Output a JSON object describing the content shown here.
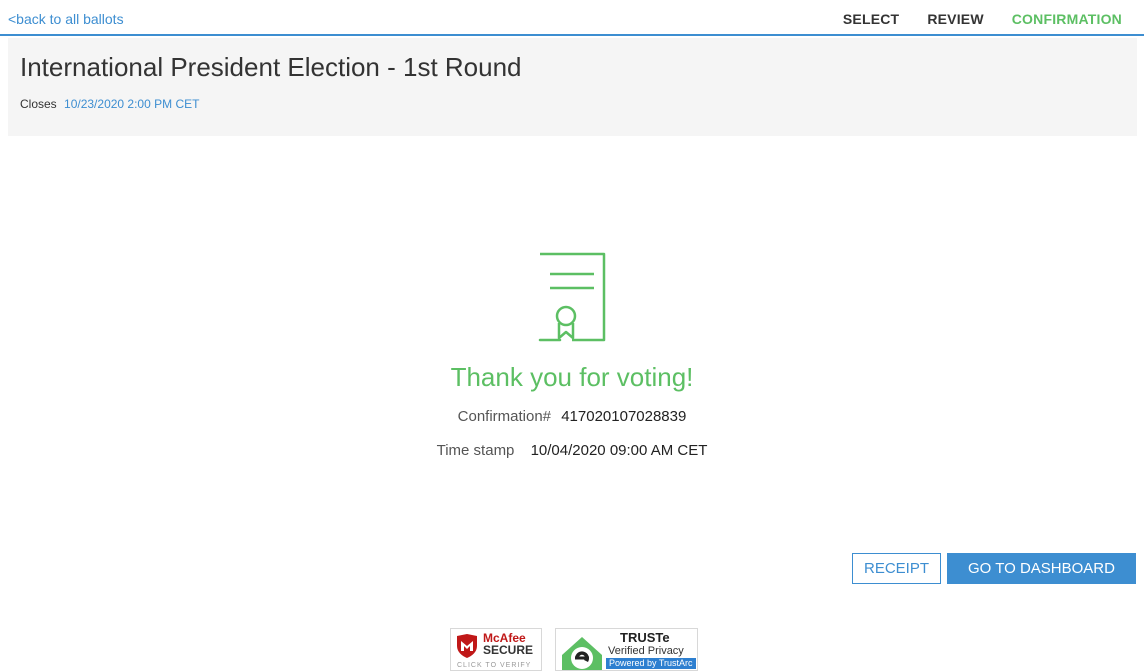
{
  "nav": {
    "back_label": "<back to all ballots",
    "steps": [
      {
        "label": "SELECT",
        "active": false
      },
      {
        "label": "REVIEW",
        "active": false
      },
      {
        "label": "CONFIRMATION",
        "active": true
      }
    ]
  },
  "election": {
    "title": "International President Election - 1st Round",
    "closes_label": "Closes",
    "closes_date": "10/23/2020 2:00 PM CET"
  },
  "confirmation": {
    "icon": "certificate-icon",
    "message": "Thank you for voting!",
    "number_label": "Confirmation#",
    "number_value": "417020107028839",
    "timestamp_label": "Time stamp",
    "timestamp_value": "10/04/2020 09:00 AM CET"
  },
  "actions": {
    "receipt_label": "RECEIPT",
    "dashboard_label": "GO TO DASHBOARD"
  },
  "badges": {
    "mcafee_name": "McAfee",
    "mcafee_secure": "SECURE",
    "mcafee_verify": "CLICK TO VERIFY",
    "truste_name": "TRUSTe",
    "truste_sub": "Verified Privacy",
    "truste_powered": "Powered by TrustArc"
  },
  "colors": {
    "accent": "#3d8ed1",
    "success": "#5cbf63",
    "header_bg": "#f5f5f5"
  }
}
